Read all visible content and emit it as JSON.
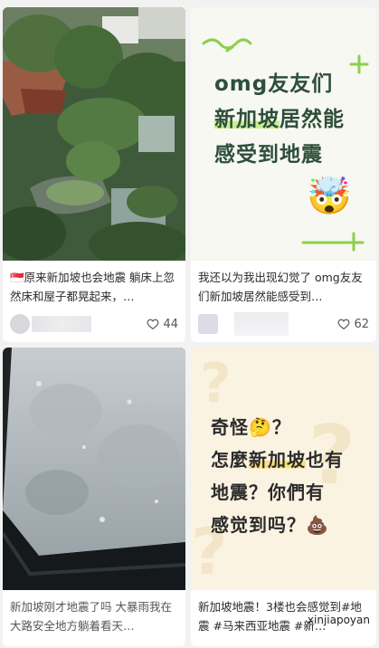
{
  "feed": {
    "posts": [
      {
        "title": "🇸🇬原来新加坡也会地震 躺床上忽然床和屋子都晃起来，…",
        "likes": "44"
      },
      {
        "title": "我还以为我出现幻觉了 omg友友们新加坡居然能感受到…",
        "likes": "62",
        "image_text": {
          "line1": "omg友友们",
          "line2_highlight": "新加坡",
          "line2_rest": "居然能",
          "line3": "感受到地震",
          "emoji": "🤯"
        }
      },
      {
        "title": "新加坡刚才地震了吗 大暴雨我在大路安全地方躺着看天…"
      },
      {
        "title": "新加坡地震！3楼也会感觉到#地震 #马来西亚地震 #新…",
        "image_text": {
          "line1": "奇怪🤔？",
          "line2_pre": "怎麼",
          "line2_highlight": "新加坡",
          "line2_post": "也有",
          "line3": "地震？你們有",
          "line4": "感觉到吗？💩"
        }
      }
    ]
  },
  "watermark": "xinjiapoyan",
  "colors": {
    "card2_bg": "#f6f8f1",
    "card2_highlight": "#c9ef8f",
    "card4_bg": "#fbf3e2",
    "card4_highlight": "#ffe07a"
  }
}
